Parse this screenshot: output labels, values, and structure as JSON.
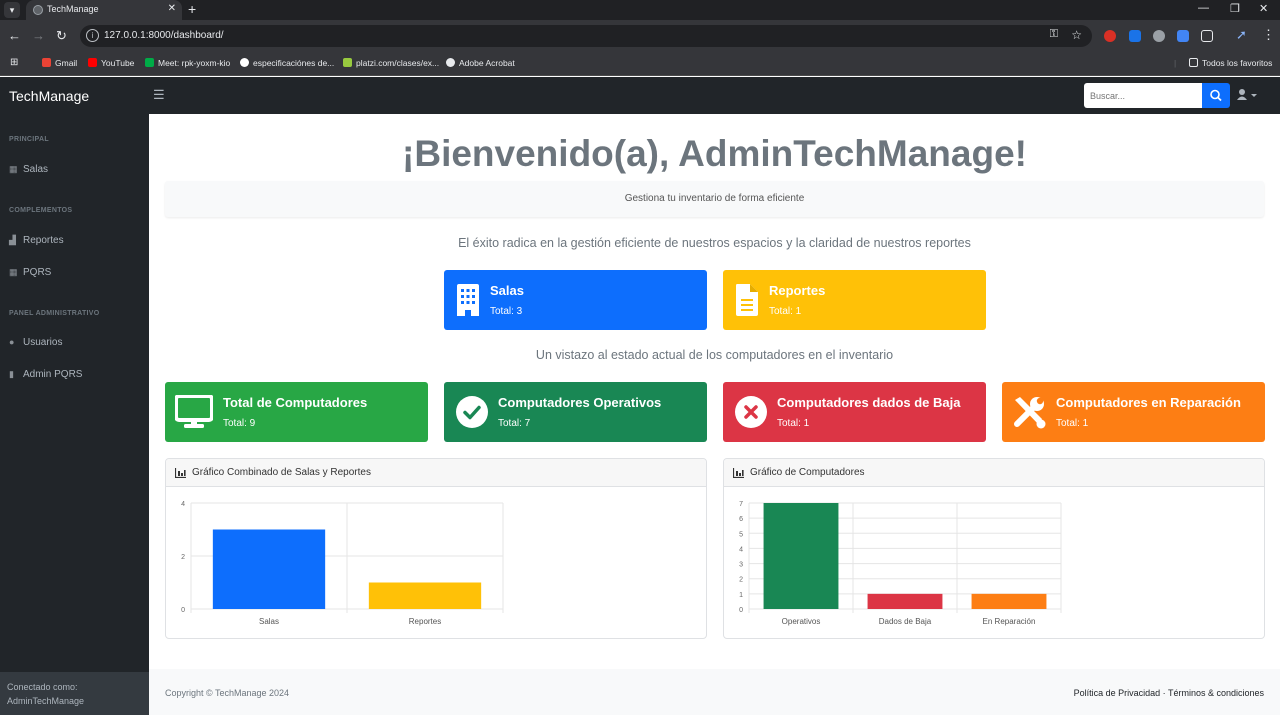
{
  "browser": {
    "tab_title": "TechManage",
    "url": "127.0.0.1:8000/dashboard/",
    "bookmarks": [
      "Gmail",
      "YouTube",
      "Meet: rpk-yoxm-kio",
      "especificaciónes de...",
      "platzi.com/clases/ex...",
      "Adobe Acrobat"
    ],
    "all_bookmarks": "Todos los favoritos"
  },
  "app": {
    "brand": "TechManage",
    "search_placeholder": "Buscar..."
  },
  "sidebar": {
    "principal_heading": "PRINCIPAL",
    "salas": "Salas",
    "complementos_heading": "COMPLEMENTOS",
    "reportes": "Reportes",
    "pqrs": "PQRS",
    "admin_heading": "PANEL ADMINISTRATIVO",
    "usuarios": "Usuarios",
    "admin_pqrs": "Admin PQRS",
    "connected_label": "Conectado como:",
    "connected_user": "AdminTechManage"
  },
  "main": {
    "welcome": "¡Bienvenido(a), AdminTechManage!",
    "tagline": "Gestiona tu inventario de forma eficiente",
    "subtitle1": "El éxito radica en la gestión eficiente de nuestros espacios y la claridad de nuestros reportes",
    "subtitle2": "Un vistazo al estado actual de los computadores en el inventario"
  },
  "cards": {
    "salas": {
      "title": "Salas",
      "value": "Total: 3",
      "color": "#0d6efd"
    },
    "reportes": {
      "title": "Reportes",
      "value": "Total: 1",
      "color": "#ffc107"
    },
    "total_pc": {
      "title": "Total de Computadores",
      "value": "Total: 9",
      "color": "#28a745"
    },
    "operativos": {
      "title": "Computadores Operativos",
      "value": "Total: 7",
      "color": "#198754"
    },
    "baja": {
      "title": "Computadores dados de Baja",
      "value": "Total: 1",
      "color": "#dc3545"
    },
    "reparacion": {
      "title": "Computadores en Reparación",
      "value": "Total: 1",
      "color": "#fd7e14"
    }
  },
  "panels": {
    "combined_title": "Gráfico Combinado de Salas y Reportes",
    "computers_title": "Gráfico de Computadores"
  },
  "chart_data": [
    {
      "type": "bar",
      "title": "Gráfico Combinado de Salas y Reportes",
      "categories": [
        "Salas",
        "Reportes"
      ],
      "values": [
        3,
        1
      ],
      "colors": [
        "#0d6efd",
        "#ffc107"
      ],
      "yticks": [
        "0",
        "2",
        "4"
      ],
      "ylim": [
        0,
        4
      ],
      "grid": true
    },
    {
      "type": "bar",
      "title": "Gráfico de Computadores",
      "categories": [
        "Operativos",
        "Dados de Baja",
        "En Reparación"
      ],
      "values": [
        7,
        1,
        1
      ],
      "colors": [
        "#198754",
        "#dc3545",
        "#fd7e14"
      ],
      "yticks": [
        "0",
        "1",
        "2",
        "3",
        "4",
        "5",
        "6",
        "7"
      ],
      "ylim": [
        0,
        7
      ],
      "grid": true
    }
  ],
  "footer": {
    "copyright": "Copyright © TechManage 2024",
    "links": "Política de Privacidad · Términos & condiciones"
  }
}
